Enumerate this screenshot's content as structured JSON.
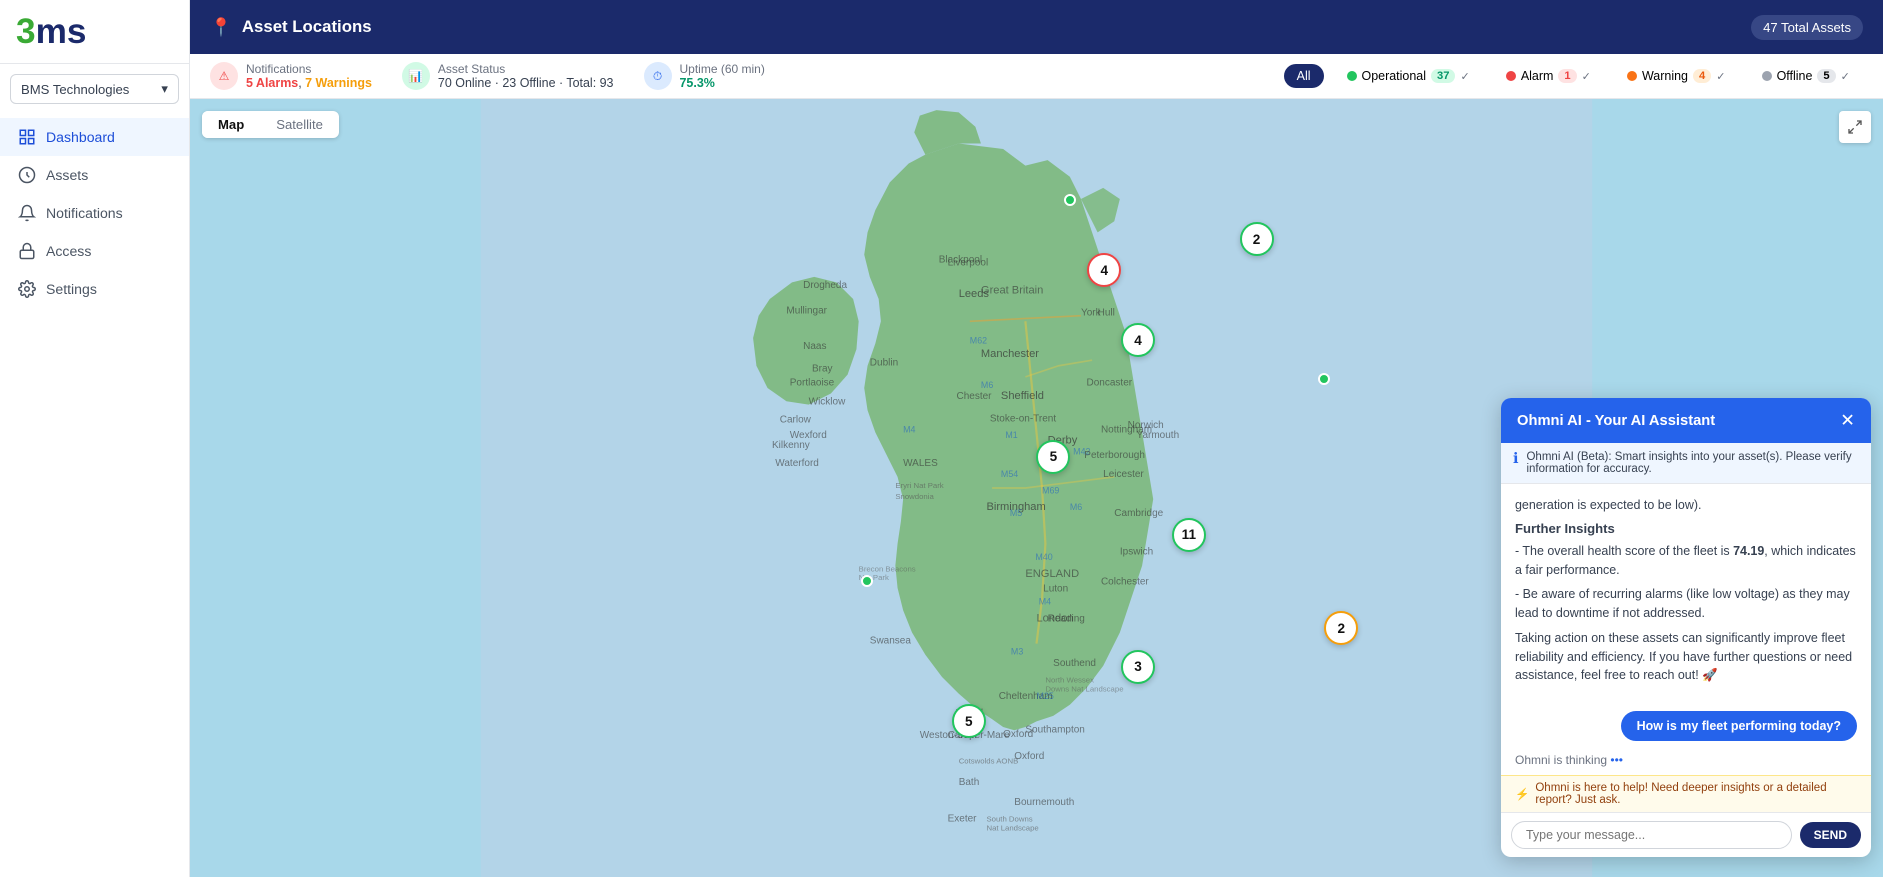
{
  "sidebar": {
    "logo": {
      "part1": "3",
      "part2": "ms"
    },
    "company": "BMS Technologies",
    "nav_items": [
      {
        "id": "dashboard",
        "label": "Dashboard",
        "active": true
      },
      {
        "id": "assets",
        "label": "Assets",
        "active": false
      },
      {
        "id": "notifications",
        "label": "Notifications",
        "active": false
      },
      {
        "id": "access",
        "label": "Access",
        "active": false
      },
      {
        "id": "settings",
        "label": "Settings",
        "active": false
      }
    ]
  },
  "header": {
    "title": "Asset Locations",
    "total_assets": "47 Total Assets"
  },
  "stats": {
    "notifications": {
      "label": "Notifications",
      "alarms": "5 Alarms",
      "warnings": "7 Warnings"
    },
    "asset_status": {
      "label": "Asset Status",
      "value": "70 Online · 23 Offline · Total: 93"
    },
    "uptime": {
      "label": "Uptime (60 min)",
      "value": "75.3%"
    }
  },
  "filters": {
    "all": "All",
    "operational": {
      "label": "Operational",
      "count": "37",
      "check": "✓"
    },
    "alarm": {
      "label": "Alarm",
      "count": "1",
      "check": "✓"
    },
    "warning": {
      "label": "Warning",
      "count": "4",
      "check": "✓"
    },
    "offline": {
      "label": "Offline",
      "count": "5",
      "check": "✓"
    }
  },
  "map": {
    "tab_map": "Map",
    "tab_satellite": "Satellite",
    "clusters": [
      {
        "id": "c1",
        "count": "2",
        "left": "63",
        "top": "18",
        "type": "normal"
      },
      {
        "id": "c2",
        "count": "4",
        "left": "54",
        "top": "22",
        "type": "alarm"
      },
      {
        "id": "c3",
        "count": "4",
        "left": "56",
        "top": "31",
        "type": "normal"
      },
      {
        "id": "c4",
        "count": "5",
        "left": "51",
        "top": "46",
        "type": "normal"
      },
      {
        "id": "c5",
        "count": "11",
        "left": "59",
        "top": "56",
        "type": "normal"
      },
      {
        "id": "c6",
        "count": "3",
        "left": "56",
        "top": "73",
        "type": "normal"
      },
      {
        "id": "c7",
        "count": "2",
        "left": "68",
        "top": "68",
        "type": "warning"
      },
      {
        "id": "c8",
        "count": "5",
        "left": "46",
        "top": "80",
        "type": "normal"
      }
    ]
  },
  "ai_panel": {
    "title": "Ohmni AI - Your AI Assistant",
    "info_text": "Ohmni AI (Beta): Smart insights into your asset(s). Please verify information for accuracy.",
    "body_text": "generation is expected to be low).",
    "section_title": "Further Insights",
    "insights": [
      "The overall health score of the fleet is 74.19, which indicates a fair performance.",
      "Be aware of recurring alarms (like low voltage) as they may lead to downtime if not addressed."
    ],
    "action_text": "Taking action on these assets can significantly improve fleet reliability and efficiency. If you have further questions or need assistance, feel free to reach out! 🚀",
    "cta_button": "How is my fleet performing today?",
    "thinking_text": "Ohmni is thinking",
    "helper_text": "Ohmni is here to help! Need deeper insights or a detailed report? Just ask.",
    "input_placeholder": "Type your message...",
    "send_label": "SEND"
  }
}
